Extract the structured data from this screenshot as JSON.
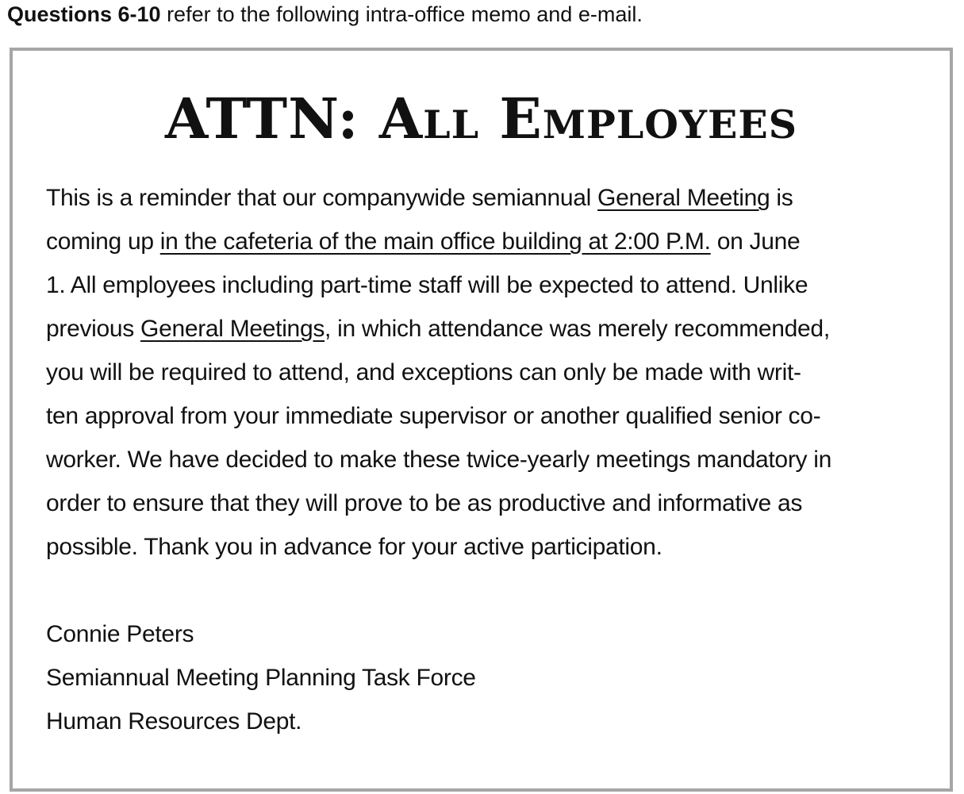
{
  "intro": {
    "bold": "Questions 6-10",
    "rest": " refer to the following intra-office memo and e-mail."
  },
  "memo": {
    "title": "ATTN: All Employees",
    "lines": [
      [
        "This is a reminder that our companywide semiannual ",
        "General Meeting",
        " is"
      ],
      [
        "coming up ",
        "in the cafeteria of the main office building at 2:00 P.M.",
        " on June"
      ],
      [
        "1. All employees including part-time staff will be expected to attend. Unlike"
      ],
      [
        "previous ",
        "General Meetings",
        ", in which attendance was merely recommended,"
      ],
      [
        "you will be required to attend, and exceptions can only be made with writ-"
      ],
      [
        "ten approval from your immediate supervisor or another qualified senior co-"
      ],
      [
        "worker. We have decided to make these twice-yearly meetings mandatory in"
      ],
      [
        "order to ensure that they will prove to be as productive and informative as"
      ],
      [
        "possible. Thank you in advance for your active participation."
      ]
    ],
    "signature": {
      "name": "Connie Peters",
      "team": "Semiannual Meeting Planning Task Force",
      "dept": "Human Resources Dept."
    }
  }
}
